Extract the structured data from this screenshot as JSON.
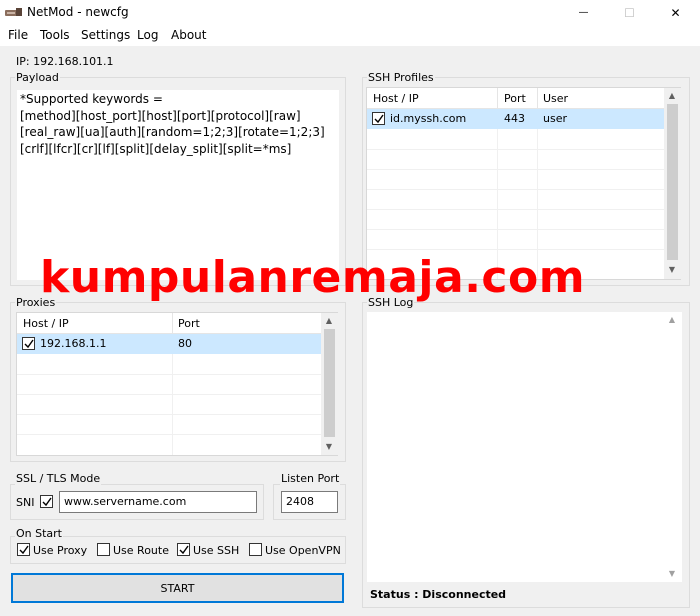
{
  "window": {
    "title": "NetMod - newcfg",
    "minimize_glyph": "—",
    "maximize_glyph": "☐",
    "close_glyph": "✕"
  },
  "menu": {
    "items": [
      "File",
      "Tools",
      "Settings",
      "Log",
      "About"
    ]
  },
  "ip_label": "IP: 192.168.101.1",
  "payload": {
    "label": "Payload",
    "text": "*Supported keywords =\n[method][host_port][host][port][protocol][raw]\n[real_raw][ua][auth][random=1;2;3][rotate=1;2;3]\n[crlf][lfcr][cr][lf][split][delay_split][split=*ms]"
  },
  "ssh_profiles": {
    "label": "SSH Profiles",
    "columns": [
      "Host / IP",
      "Port",
      "User"
    ],
    "rows": [
      {
        "host": "id.myssh.com",
        "port": "443",
        "user": "user",
        "checked": true
      }
    ]
  },
  "proxies": {
    "label": "Proxies",
    "columns": [
      "Host / IP",
      "Port"
    ],
    "rows": [
      {
        "host": "192.168.1.1",
        "port": "80",
        "checked": true
      }
    ]
  },
  "ssh_log": {
    "label": "SSH Log"
  },
  "ssl": {
    "label": "SSL / TLS Mode",
    "sni_label": "SNI",
    "sni_checked": true,
    "sni_value": "www.servername.com"
  },
  "listen_port": {
    "label": "Listen Port",
    "value": "2408"
  },
  "on_start": {
    "label": "On Start",
    "options": [
      {
        "label": "Use Proxy",
        "checked": true
      },
      {
        "label": "Use Route",
        "checked": false
      },
      {
        "label": "Use SSH",
        "checked": true
      },
      {
        "label": "Use OpenVPN",
        "checked": false
      }
    ]
  },
  "start_button": "START",
  "status": "Status : Disconnected",
  "watermark": "kumpulanremaja.com",
  "icons": {
    "app": "netmod-app-icon",
    "check": "checkmark-icon",
    "scroll_up": "chevron-up-icon",
    "scroll_down": "chevron-down-icon"
  }
}
